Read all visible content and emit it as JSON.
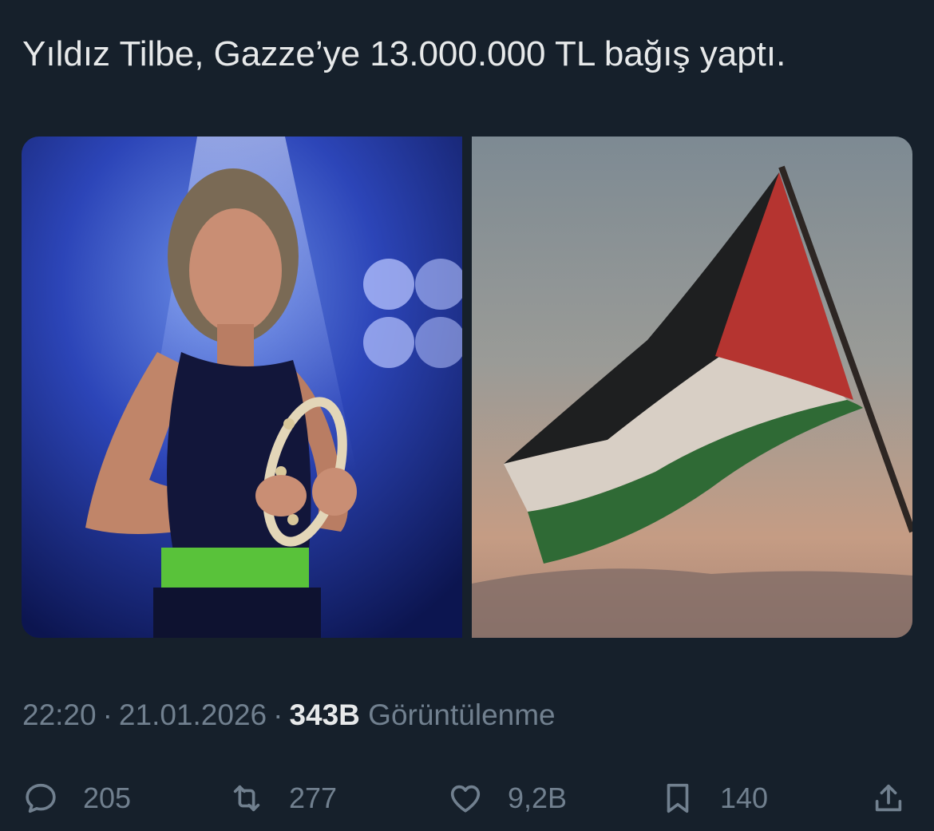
{
  "tweet": {
    "text": "Yıldız Tilbe, Gazze’ye 13.000.000 TL bağış yaptı.",
    "time": "22:20",
    "date": "21.01.2026",
    "separator": "·",
    "views_count": "343B",
    "views_label": "Görüntülenme"
  },
  "media": {
    "images": [
      {
        "icon": "performer-photo"
      },
      {
        "icon": "palestinian-flag-photo"
      }
    ]
  },
  "actions": {
    "replies": "205",
    "retweets": "277",
    "likes": "9,2B",
    "bookmarks": "140"
  },
  "colors": {
    "background": "#16202b",
    "text": "#e7e9ea",
    "muted": "#71808f"
  }
}
